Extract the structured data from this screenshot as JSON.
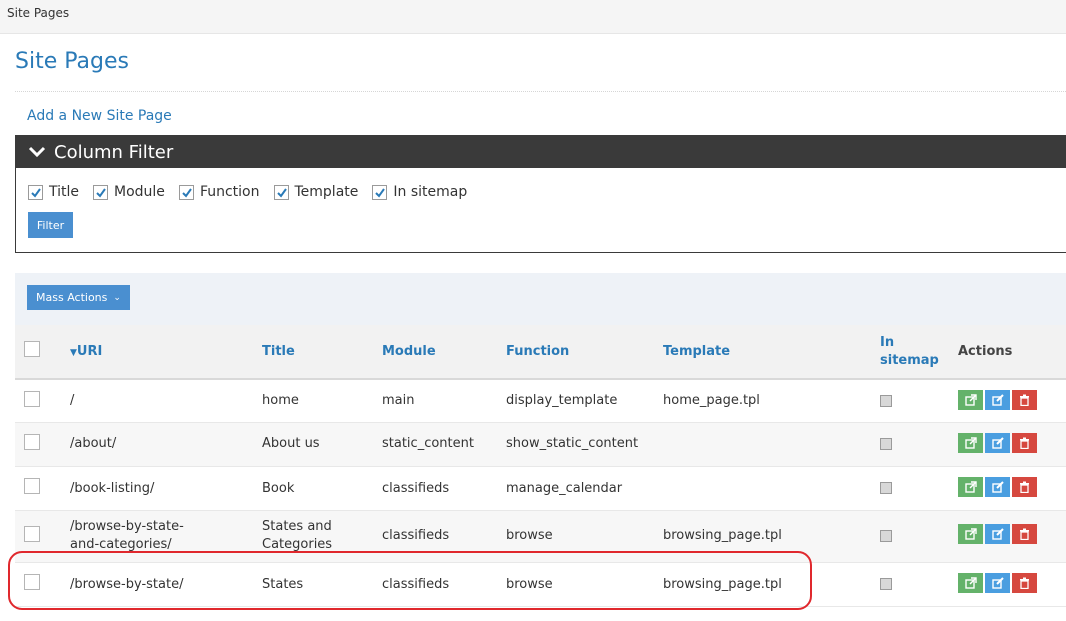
{
  "breadcrumb": "Site Pages",
  "page_title": "Site Pages",
  "add_link": "Add a New Site Page",
  "column_filter": {
    "heading": "Column Filter",
    "options": [
      {
        "label": "Title",
        "checked": true
      },
      {
        "label": "Module",
        "checked": true
      },
      {
        "label": "Function",
        "checked": true
      },
      {
        "label": "Template",
        "checked": true
      },
      {
        "label": "In sitemap",
        "checked": true
      }
    ],
    "filter_button": "Filter"
  },
  "mass_actions": "Mass Actions",
  "table": {
    "headers": {
      "uri": "URI",
      "title": "Title",
      "module": "Module",
      "function": "Function",
      "template": "Template",
      "in_sitemap_1": "In",
      "in_sitemap_2": "sitemap",
      "actions": "Actions"
    },
    "rows": [
      {
        "uri": "/",
        "title": "home",
        "module": "main",
        "function": "display_template",
        "template": "home_page.tpl"
      },
      {
        "uri": "/about/",
        "title": "About us",
        "module": "static_content",
        "function": "show_static_content",
        "template": ""
      },
      {
        "uri": "/book-listing/",
        "title": "Book",
        "module": "classifieds",
        "function": "manage_calendar",
        "template": ""
      },
      {
        "uri_1": "/browse-by-state-",
        "uri_2": "and-categories/",
        "title_1": "States and",
        "title_2": "Categories",
        "module": "classifieds",
        "function": "browse",
        "template": "browsing_page.tpl"
      },
      {
        "uri": "/browse-by-state/",
        "title": "States",
        "module": "classifieds",
        "function": "browse",
        "template": "browsing_page.tpl"
      }
    ]
  },
  "colors": {
    "link": "#2a7ab7",
    "primary_button": "#4a8fd0",
    "view_action": "#64b26a",
    "edit_action": "#4a9ee0",
    "delete_action": "#d6483f",
    "highlight": "#e0282d"
  }
}
